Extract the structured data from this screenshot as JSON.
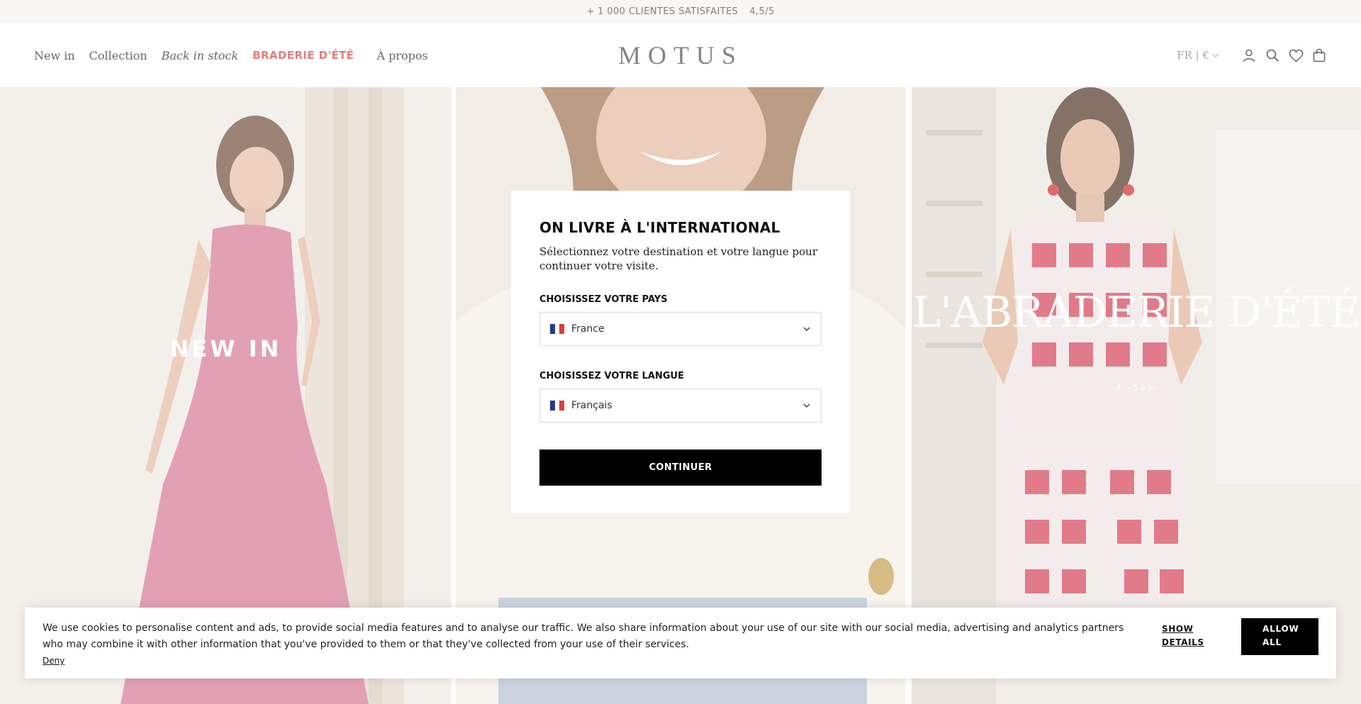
{
  "announcement": {
    "customers": "+ 1 000 CLIENTES SATISFAITES",
    "rating": "4,5/5"
  },
  "header": {
    "nav": [
      {
        "label": "New in"
      },
      {
        "label": "Collection"
      },
      {
        "label": "Back in stock"
      },
      {
        "label": "BRADERIE D'ÉTÉ"
      },
      {
        "label": "À propos"
      }
    ],
    "logo": "MOTUS",
    "locale": "FR | €",
    "icons": [
      "account-icon",
      "search-icon",
      "wishlist-heart-icon",
      "cart-bag-icon"
    ]
  },
  "hero": {
    "panels": [
      {
        "label": "NEW IN"
      },
      {
        "label": ""
      },
      {
        "label": "L'ABRADERIE D'ÉTÉ",
        "sub": "A -50%"
      }
    ]
  },
  "modal": {
    "title": "ON LIVRE À L'INTERNATIONAL",
    "description": "Sélectionnez votre destination et votre langue pour continuer votre visite.",
    "country_label": "CHOISISSEZ VOTRE PAYS",
    "country_value": "France",
    "language_label": "CHOISISSEZ VOTRE LANGUE",
    "language_value": "Français",
    "continue": "CONTINUER"
  },
  "cookie": {
    "text": "We use cookies to personalise content and ads, to provide social media features and to analyse our traffic. We also share information about your use of our site with our social media, advertising and analytics partners who may combine it with other information that you've provided to them or that they've collected from your use of their services.",
    "deny": "Deny",
    "show_details": "SHOW DETAILS",
    "allow_all": "ALLOW ALL"
  },
  "colors": {
    "sale": "#d9534f",
    "button": "#000000",
    "announcement_bg": "#f6f5f2"
  }
}
